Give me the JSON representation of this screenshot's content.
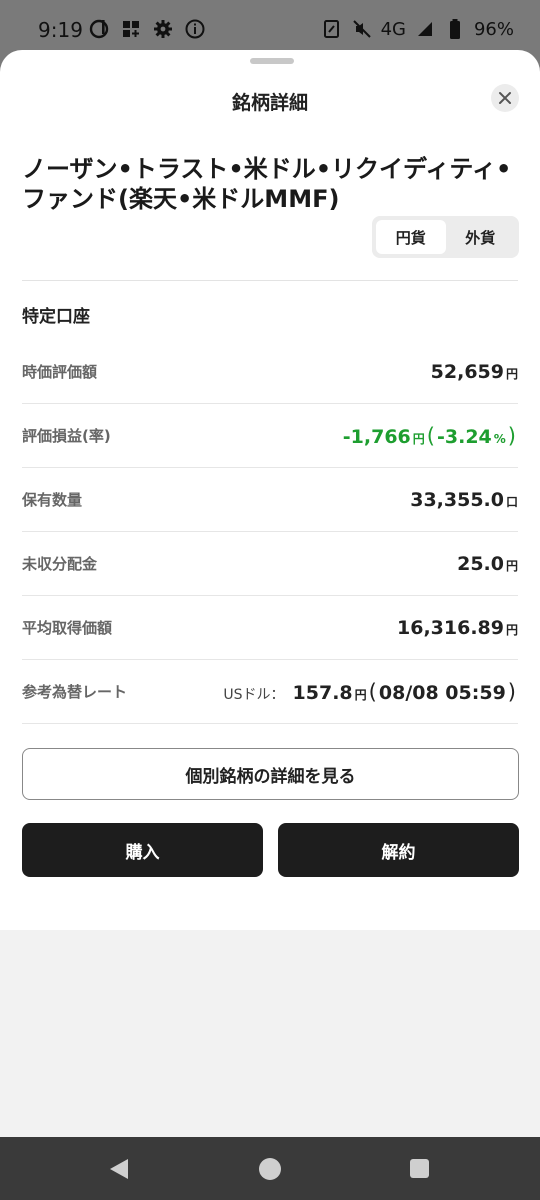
{
  "status_bar": {
    "time": "9:19",
    "left_icons": [
      "docomo-d-icon",
      "widgets-icon",
      "settings-icon",
      "info-icon"
    ],
    "network": "4G",
    "battery": "96%"
  },
  "sheet": {
    "title": "銘柄詳細",
    "fund_name": "ノーザン•トラスト•米ドル•リクイディティ•ファンド(楽天•米ドルMMF)",
    "currency_toggle": {
      "options": [
        "円貨",
        "外貨"
      ],
      "selected": "円貨"
    },
    "account_label": "特定口座"
  },
  "details": {
    "market_value": {
      "label": "時価評価額",
      "value": "52,659",
      "unit": "円"
    },
    "unrealized_pl": {
      "label": "評価損益(率)",
      "value": "-1,766",
      "unit": "円",
      "rate": "-3.24",
      "rate_unit": "%",
      "color": "#1e9e30"
    },
    "quantity": {
      "label": "保有数量",
      "value": "33,355.0",
      "unit": "口"
    },
    "undistributed": {
      "label": "未収分配金",
      "value": "25.0",
      "unit": "円"
    },
    "avg_cost": {
      "label": "平均取得価額",
      "value": "16,316.89",
      "unit": "円"
    },
    "fx_rate": {
      "label": "参考為替レート",
      "currency_label": "USドル：",
      "value": "157.8",
      "unit": "円",
      "datetime": "08/08 05:59"
    }
  },
  "buttons": {
    "detail": "個別銘柄の詳細を見る",
    "buy": "購入",
    "sell": "解約"
  },
  "nav": {
    "icons": [
      "back-icon",
      "home-icon",
      "recents-icon"
    ]
  }
}
